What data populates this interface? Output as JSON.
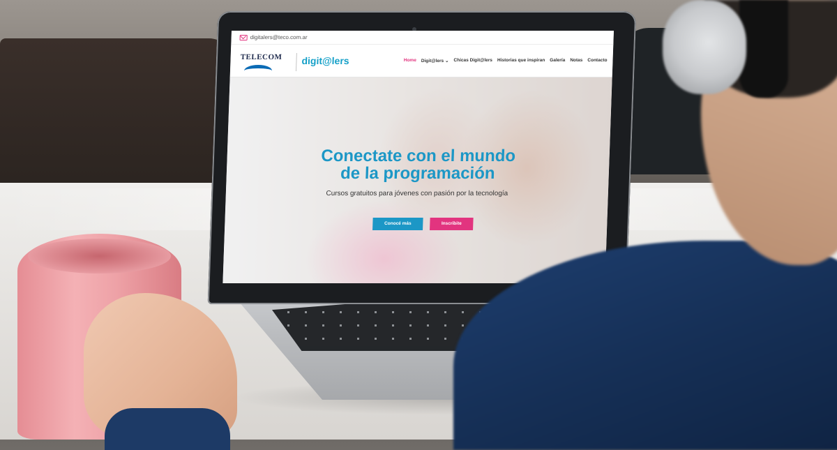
{
  "website": {
    "topbar": {
      "email": "digitalers@teco.com.ar",
      "mail_icon": "mail-icon"
    },
    "brand": {
      "telecom": "TELECOM",
      "digitalers": "digit@lers"
    },
    "nav": [
      {
        "label": "Home",
        "active": true
      },
      {
        "label": "Digit@lers ⌄",
        "active": false
      },
      {
        "label": "Chicas Digit@lers",
        "active": false
      },
      {
        "label": "Historias que inspiran",
        "active": false
      },
      {
        "label": "Galería",
        "active": false
      },
      {
        "label": "Notas",
        "active": false
      },
      {
        "label": "Contacto",
        "active": false
      }
    ],
    "hero": {
      "title_line1": "Conectate con el mundo",
      "title_line2": "de la programación",
      "subtitle": "Cursos gratuitos para jóvenes con pasión por la tecnología",
      "button_primary": "Conocé más",
      "button_secondary": "Inscribite"
    }
  },
  "colors": {
    "accent_blue": "#1c97c6",
    "accent_pink": "#e2347f",
    "brand_navy": "#1f2b4d"
  }
}
